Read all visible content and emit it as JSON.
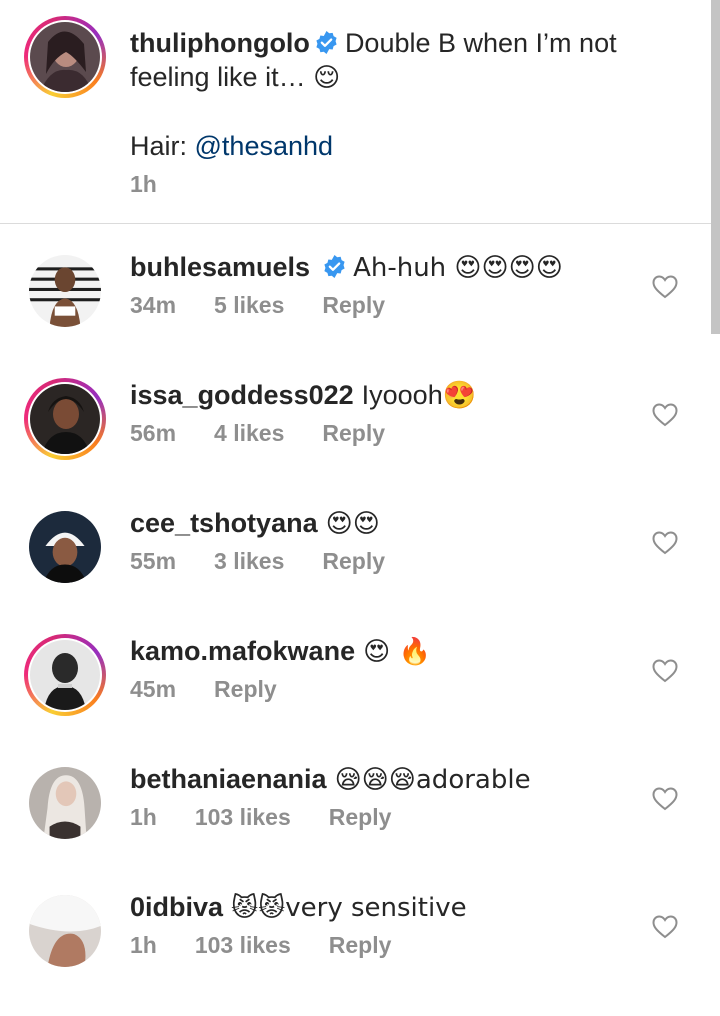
{
  "caption": {
    "username": "thuliphongolo",
    "text_line1": "Double B when I’m not",
    "text_line2": "feeling like it… ",
    "emoji": "😌",
    "hair_label": "Hair: ",
    "hair_mention": "@thesanhd",
    "time": "1h"
  },
  "comments": [
    {
      "username": "buhlesamuels",
      "text": "Ah-huh 😍😍😍😍",
      "time": "34m",
      "likes": "5 likes",
      "reply": "Reply"
    },
    {
      "username": "issa_goddess022",
      "text": "Iyoooh😍",
      "time": "56m",
      "likes": "4 likes",
      "reply": "Reply"
    },
    {
      "username": "cee_tshotyana",
      "text": "😍😍",
      "time": "55m",
      "likes": "3 likes",
      "reply": "Reply"
    },
    {
      "username": "kamo.mafokwane",
      "text": "😍 🔥",
      "time": "45m",
      "likes": "",
      "reply": "Reply"
    },
    {
      "username": "bethaniaenania",
      "text": "😪😪😪adorable",
      "time": "1h",
      "likes": "103 likes",
      "reply": "Reply"
    },
    {
      "username": "0idbiva",
      "text": "😾😾very sensitive",
      "time": "1h",
      "likes": "103 likes",
      "reply": "Reply"
    }
  ],
  "icons": {
    "verified": "verified-badge-icon",
    "like": "heart-outline-icon"
  },
  "colors": {
    "verified": "#3897f0",
    "meta": "#8e8e8e",
    "mention": "#00376b",
    "text": "#262626"
  }
}
